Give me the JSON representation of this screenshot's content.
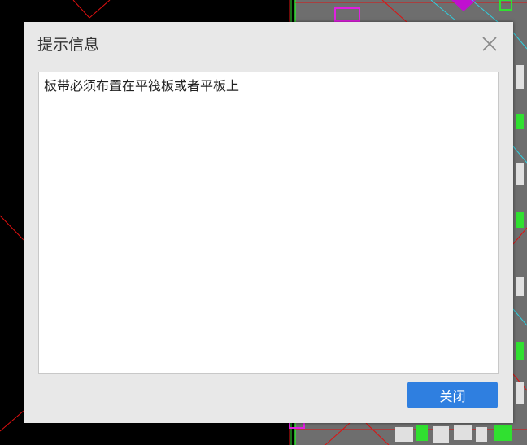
{
  "dialog": {
    "title": "提示信息",
    "message": "板带必须布置在平筏板或者平板上",
    "close_button_label": "关闭"
  },
  "icons": {
    "close": "close-icon"
  },
  "colors": {
    "dialog_bg": "#e8e8e8",
    "message_bg": "#ffffff",
    "button_bg": "#2f7fe0",
    "button_text": "#ffffff",
    "cad_background": "#000000"
  }
}
